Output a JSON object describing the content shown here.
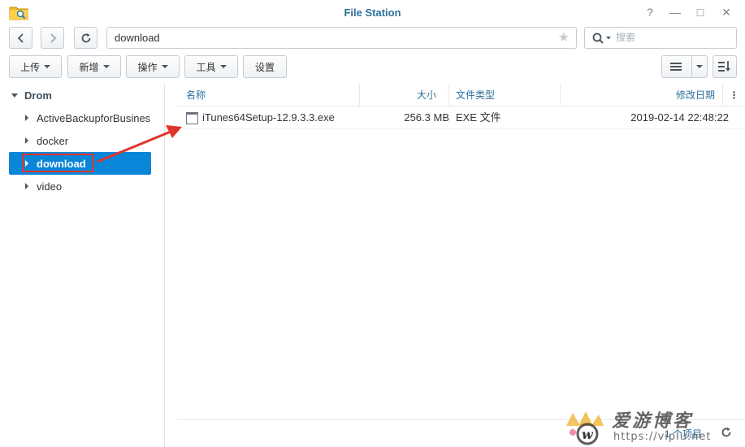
{
  "window": {
    "title": "File Station"
  },
  "window_buttons": {
    "help": "?",
    "minimize": "—",
    "maximize": "□",
    "close": "✕"
  },
  "navigation": {
    "path": "download",
    "search_placeholder": "搜索"
  },
  "toolbar": {
    "upload_label": "上传",
    "new_label": "新增",
    "action_label": "操作",
    "tools_label": "工具",
    "settings_label": "设置"
  },
  "sidebar": {
    "root_label": "Drom",
    "items": [
      {
        "label": "ActiveBackupforBusines",
        "selected": false
      },
      {
        "label": "docker",
        "selected": false
      },
      {
        "label": "download",
        "selected": true
      },
      {
        "label": "video",
        "selected": false
      }
    ]
  },
  "file_list": {
    "columns": {
      "name": "名称",
      "size": "大小",
      "type": "文件类型",
      "modified": "修改日期"
    },
    "rows": [
      {
        "name": "iTunes64Setup-12.9.3.3.exe",
        "size": "256.3 MB",
        "type": "EXE 文件",
        "modified": "2019-02-14 22:48:22"
      }
    ]
  },
  "footer": {
    "item_count": "1 个项目"
  },
  "watermark": {
    "text": "爱游博客",
    "url": "https://vipiu.net"
  },
  "colors": {
    "accent": "#0a86d9",
    "title": "#2d6f9c",
    "highlight_box": "#e0342c"
  },
  "icons": {
    "app": "folder-search-icon",
    "back": "chevron-left-icon",
    "forward": "chevron-right-icon",
    "refresh": "refresh-icon",
    "favorite": "star-icon",
    "search": "search-icon",
    "list_view": "list-view-icon",
    "sort": "sort-icon",
    "file": "file-icon"
  }
}
